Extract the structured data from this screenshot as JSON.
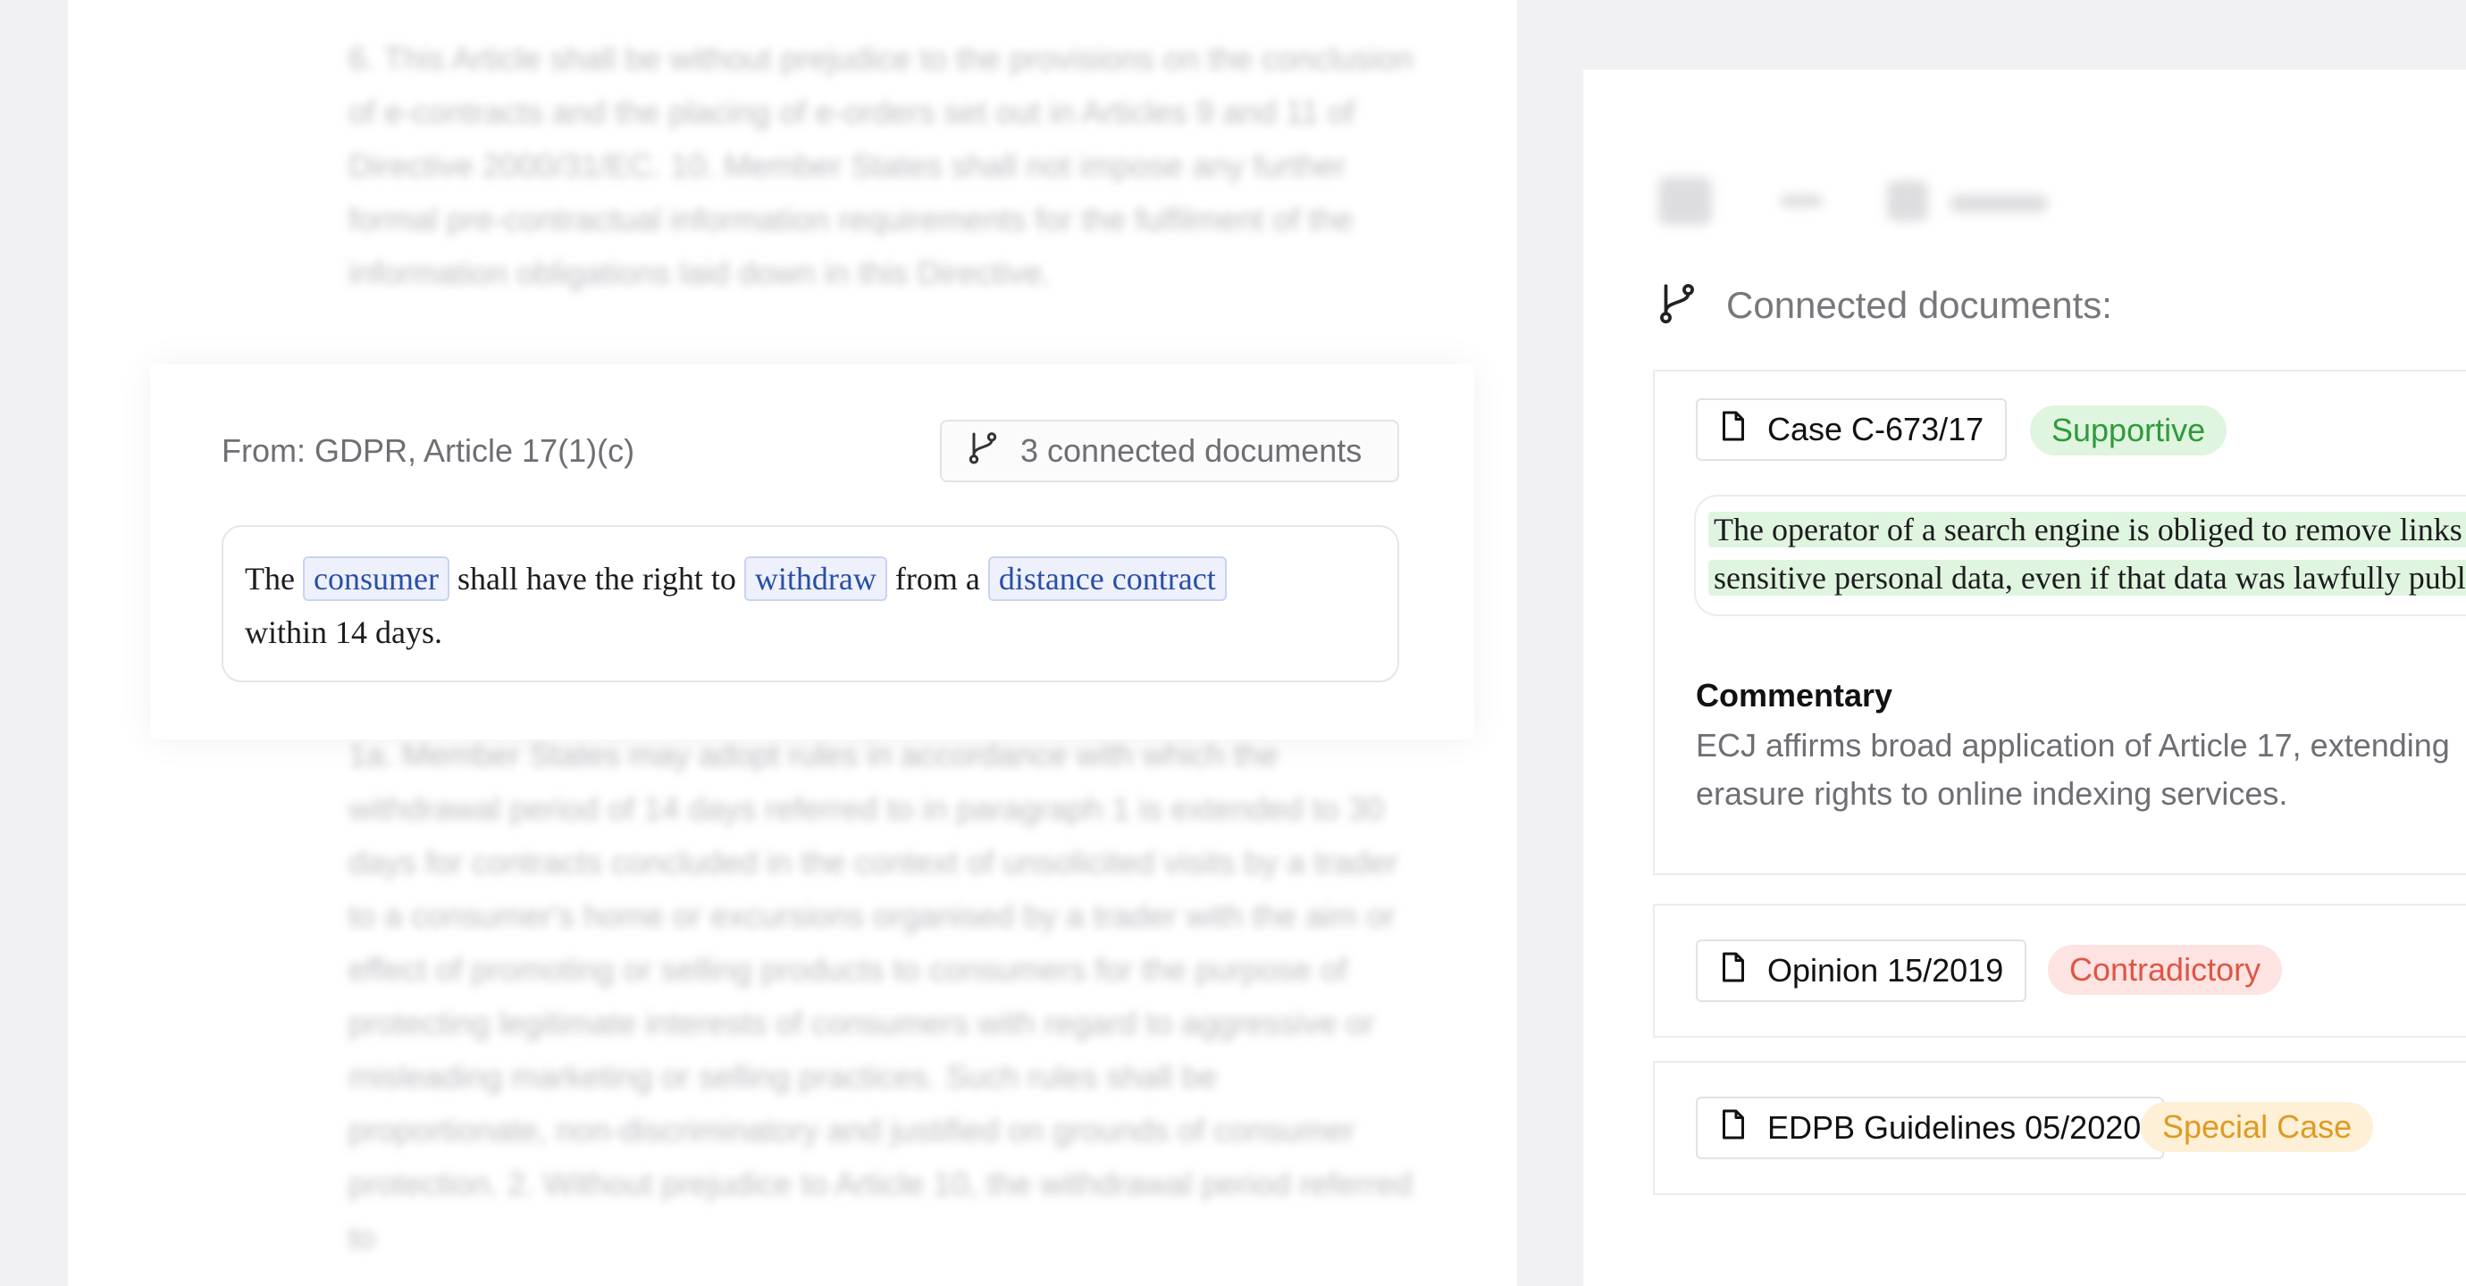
{
  "document": {
    "blurred_top": "6. This Article shall be without prejudice to the provisions on the conclusion of e-contracts and the placing of e-orders set out in Articles 9 and 11 of Directive 2000/31/EC. 10. Member States shall not impose any further formal pre-contractual information requirements for the fulfilment of the information obligations laid down in this Directive.",
    "blurred_bottom": "1a. Member States may adopt rules in accordance with which the withdrawal period of 14 days referred to in paragraph 1 is extended to 30 days for contracts concluded in the context of unsolicited visits by a trader to a consumer's home or excursions organised by a trader with the aim or effect of promoting or selling products to consumers for the purpose of protecting legitimate interests of consumers with regard to aggressive or misleading marketing or selling practices. Such rules shall be proportionate, non-discriminatory and justified on grounds of consumer protection. 2. Without prejudice to Article 10, the withdrawal period referred to"
  },
  "focus": {
    "source": "From: GDPR, Article 17(1)(c)",
    "connected_label": "3 connected documents",
    "quote": {
      "w1": "The",
      "t1": "consumer",
      "w2": "shall have the right to",
      "t2": "withdraw",
      "w3": "from a",
      "t3": "distance contract",
      "w4": "within 14 days."
    }
  },
  "panel": {
    "title": "Connected documents:",
    "documents": [
      {
        "name": "Case C-673/17",
        "status": "Supportive",
        "quote_line1": "The operator of a search engine is obliged to remove links to",
        "quote_line2": "sensitive personal data, even if that data was lawfully published",
        "commentary_title": "Commentary",
        "commentary": "ECJ affirms broad application of Article 17, extending erasure rights to online indexing services."
      },
      {
        "name": "Opinion 15/2019",
        "status": "Contradictory"
      },
      {
        "name": "EDPB Guidelines 05/2020",
        "status": "Special Case"
      }
    ]
  },
  "colors": {
    "supportive": "#2f9a3c",
    "contradictory": "#e05545",
    "special_case": "#e09a22",
    "term_highlight": "#2a4fa8"
  },
  "icons": [
    "branch-icon",
    "file-icon"
  ]
}
